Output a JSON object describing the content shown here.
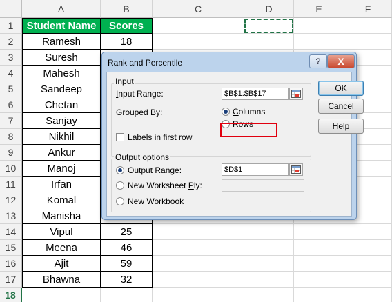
{
  "sheet": {
    "columns": [
      "A",
      "B",
      "C",
      "D",
      "E",
      "F"
    ],
    "rows": [
      "1",
      "2",
      "3",
      "4",
      "5",
      "6",
      "7",
      "8",
      "9",
      "10",
      "11",
      "12",
      "13",
      "14",
      "15",
      "16",
      "17",
      "18"
    ],
    "headers": {
      "name": "Student Name",
      "score": "Scores"
    },
    "names": [
      "Ramesh",
      "Suresh",
      "Mahesh",
      "Sandeep",
      "Chetan",
      "Sanjay",
      "Nikhil",
      "Ankur",
      "Manoj",
      "Irfan",
      "Komal",
      "Manisha",
      "Vipul",
      "Meena",
      "Ajit",
      "Bhawna"
    ],
    "scores": [
      "18",
      "",
      "",
      "",
      "",
      "",
      "",
      "",
      "",
      "",
      "",
      "",
      "25",
      "46",
      "59",
      "32"
    ],
    "header_fill": "#00b050"
  },
  "dialog": {
    "title": "Rank and Percentile",
    "help_label": "?",
    "close_label": "X",
    "input_group": "Input",
    "input_range_label_u": "I",
    "input_range_label_rest": "nput Range:",
    "input_range_value": "$B$1:$B$17",
    "grouped_by_label": "Grouped By:",
    "columns_u": "C",
    "columns_rest": "olumns",
    "rows_u": "R",
    "rows_rest": "ows",
    "labels_u": "L",
    "labels_rest": "abels in first row",
    "output_group": "Output options",
    "output_range_u": "O",
    "output_range_rest": "utput Range:",
    "output_range_value": "$D$1",
    "new_ws_pre": "New Worksheet ",
    "new_ws_u": "P",
    "new_ws_post": "ly:",
    "new_ws_value": "",
    "new_wb_pre": "New ",
    "new_wb_u": "W",
    "new_wb_post": "orkbook",
    "ok_label": "OK",
    "cancel_label": "Cancel",
    "help_btn_u": "H",
    "help_btn_rest": "elp",
    "highlight_color": "#e1000f"
  },
  "icons": {
    "range_picker": "range-select-icon"
  }
}
